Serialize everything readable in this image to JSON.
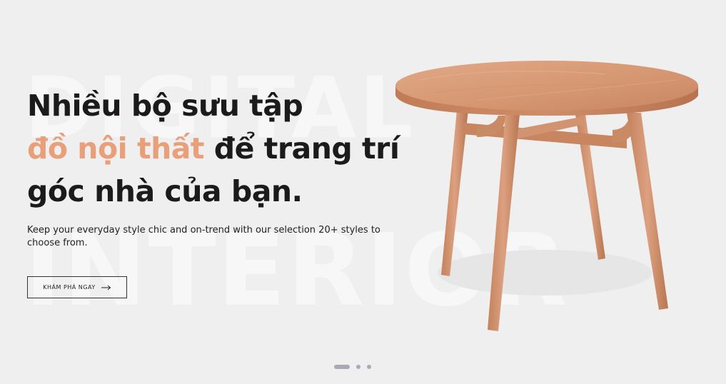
{
  "hero": {
    "watermark_top": "DIGITAL",
    "watermark_bottom": "INTERIOR",
    "headline_line1": "Nhiều bộ sưu tập",
    "headline_accent": "đồ nội thất",
    "headline_line2_rest": " để trang trí",
    "headline_line3": "góc nhà của bạn.",
    "subtitle": "Keep your everyday style chic and on-trend with our selection 20+ styles to choose from.",
    "cta_label": "KHÁM PHÁ NGAY",
    "accent_color": "#e8a07b"
  },
  "product_image": {
    "subject": "round wooden dining table"
  },
  "slider": {
    "slide_count": 3,
    "active_index": 0
  },
  "icons": {
    "cta_icon": "arrow-right-icon"
  }
}
